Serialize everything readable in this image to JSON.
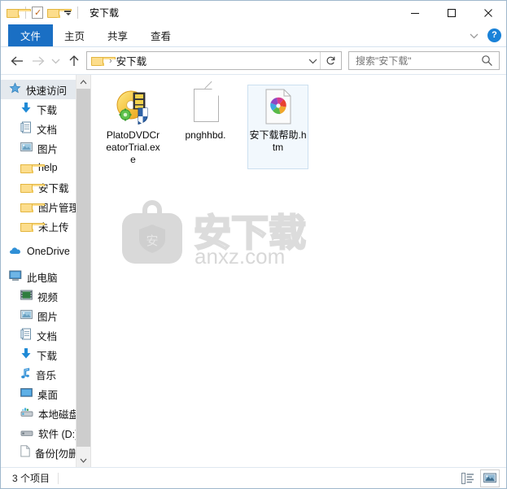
{
  "window": {
    "title": "安下载",
    "quick_access": [
      {
        "name": "folder-icon",
        "label": "文件夹"
      },
      {
        "name": "properties-icon",
        "label": "属性"
      },
      {
        "name": "new-folder-icon",
        "label": "新建文件夹"
      },
      {
        "name": "customize-chevron-icon",
        "label": "自定义快速访问工具栏"
      }
    ],
    "controls": {
      "minimize": "—",
      "maximize": "☐",
      "close": "✕"
    }
  },
  "ribbon": {
    "tabs": [
      {
        "label": "文件",
        "active": true
      },
      {
        "label": "主页",
        "active": false
      },
      {
        "label": "共享",
        "active": false
      },
      {
        "label": "查看",
        "active": false
      }
    ],
    "collapse_icon": "chevron-down-icon",
    "help_label": "?"
  },
  "address": {
    "back_label": "←",
    "forward_label": "→",
    "recent_label": "⌄",
    "up_label": "↑",
    "breadcrumb_separator": "›",
    "breadcrumb": "安下载",
    "dropdown_label": "⌄",
    "refresh_label": "↻"
  },
  "search": {
    "placeholder": "搜索\"安下载\"",
    "value": "",
    "icon": "search-icon"
  },
  "sidebar": {
    "items": [
      {
        "label": "快速访问",
        "icon": "star-icon",
        "indent": 0,
        "selected": true,
        "pinned": false
      },
      {
        "label": "下载",
        "icon": "download-arrow-icon",
        "indent": 1,
        "selected": false,
        "pinned": true
      },
      {
        "label": "文档",
        "icon": "documents-icon",
        "indent": 1,
        "selected": false,
        "pinned": true
      },
      {
        "label": "图片",
        "icon": "pictures-icon",
        "indent": 1,
        "selected": false,
        "pinned": true
      },
      {
        "label": "help",
        "icon": "folder-icon",
        "indent": 1,
        "selected": false,
        "pinned": false
      },
      {
        "label": "安下载",
        "icon": "folder-icon",
        "indent": 1,
        "selected": false,
        "pinned": false
      },
      {
        "label": "图片管理器",
        "icon": "folder-icon",
        "indent": 1,
        "selected": false,
        "pinned": false
      },
      {
        "label": "未上传",
        "icon": "folder-icon",
        "indent": 1,
        "selected": false,
        "pinned": false
      },
      {
        "label": "OneDrive",
        "icon": "onedrive-cloud-icon",
        "indent": 0,
        "selected": false,
        "pinned": false
      },
      {
        "label": "此电脑",
        "icon": "this-pc-icon",
        "indent": 0,
        "selected": false,
        "pinned": false
      },
      {
        "label": "视频",
        "icon": "videos-icon",
        "indent": 1,
        "selected": false,
        "pinned": false
      },
      {
        "label": "图片",
        "icon": "pictures-icon",
        "indent": 1,
        "selected": false,
        "pinned": false
      },
      {
        "label": "文档",
        "icon": "documents-icon",
        "indent": 1,
        "selected": false,
        "pinned": false
      },
      {
        "label": "下载",
        "icon": "download-arrow-icon",
        "indent": 1,
        "selected": false,
        "pinned": false
      },
      {
        "label": "音乐",
        "icon": "music-note-icon",
        "indent": 1,
        "selected": false,
        "pinned": false
      },
      {
        "label": "桌面",
        "icon": "desktop-icon",
        "indent": 1,
        "selected": false,
        "pinned": false
      },
      {
        "label": "本地磁盘 (C:)",
        "icon": "local-disk-icon",
        "indent": 1,
        "selected": false,
        "pinned": false
      },
      {
        "label": "软件 (D:)",
        "icon": "drive-icon",
        "indent": 1,
        "selected": false,
        "pinned": false
      },
      {
        "label": "备份[勿删]",
        "icon": "page-icon",
        "indent": 1,
        "selected": false,
        "pinned": false
      }
    ],
    "scroll_up_icon": "chevron-up-icon",
    "scroll_down_icon": "chevron-down-icon"
  },
  "files": [
    {
      "name": "PlatoDVDCreatorTrial.exe",
      "icon": "dvd-creator-app-icon",
      "selected": false
    },
    {
      "name": "pnghhbd.",
      "icon": "blank-document-icon",
      "selected": false
    },
    {
      "name": "安下载帮助.htm",
      "icon": "html-chrome-document-icon",
      "selected": true
    }
  ],
  "watermark": {
    "brand": "安下载",
    "domain": "anxz.com",
    "shield_char": "安"
  },
  "statusbar": {
    "item_count": "3 个项目",
    "views": [
      {
        "name": "details-view-button",
        "active": false
      },
      {
        "name": "large-icons-view-button",
        "active": true
      }
    ]
  },
  "colors": {
    "accent_blue": "#1a6fc4",
    "selection_border": "#cce0f0",
    "selection_fill": "#f2f8fd",
    "window_border": "#9fb7cc",
    "folder_yellow": "#fcdd8c"
  }
}
